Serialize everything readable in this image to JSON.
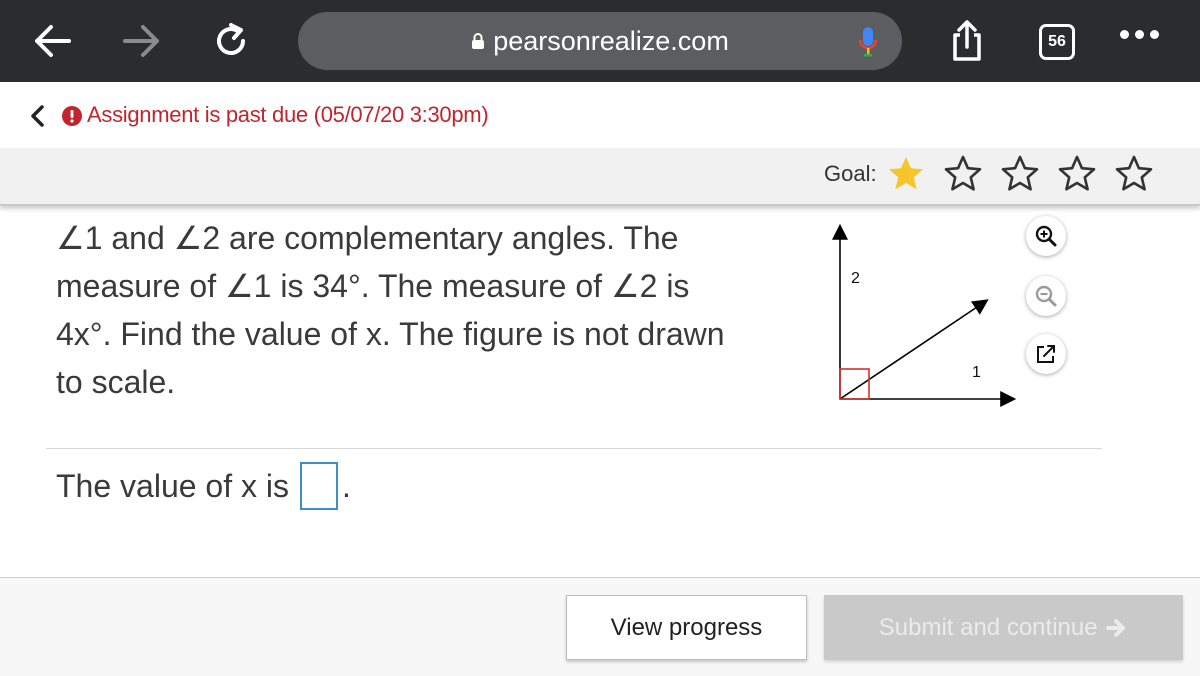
{
  "browser": {
    "url": "pearsonrealize.com",
    "tab_count": "56"
  },
  "assignment": {
    "due_notice": "Assignment is past due (05/07/20 3:30pm)"
  },
  "goal": {
    "label": "Goal:",
    "stars_total": 5,
    "stars_filled": 1,
    "filled_color": "#f6c42b"
  },
  "question": {
    "line1": "∠1 and ∠2 are complementary angles. The",
    "line2": "measure of ∠1 is 34°. The measure of ∠2 is",
    "line3": "4x°. Find the value of x. The figure is not drawn",
    "line4": "to scale."
  },
  "figure": {
    "label_angle2": "2",
    "label_angle1": "1"
  },
  "answer": {
    "prefix": "The value of x is",
    "suffix": "."
  },
  "footer": {
    "view_progress": "View progress",
    "submit": "Submit and continue"
  },
  "colors": {
    "alert": "#c2242f",
    "input_border": "#3f8ec9",
    "right_angle_marker": "#d0312d"
  }
}
